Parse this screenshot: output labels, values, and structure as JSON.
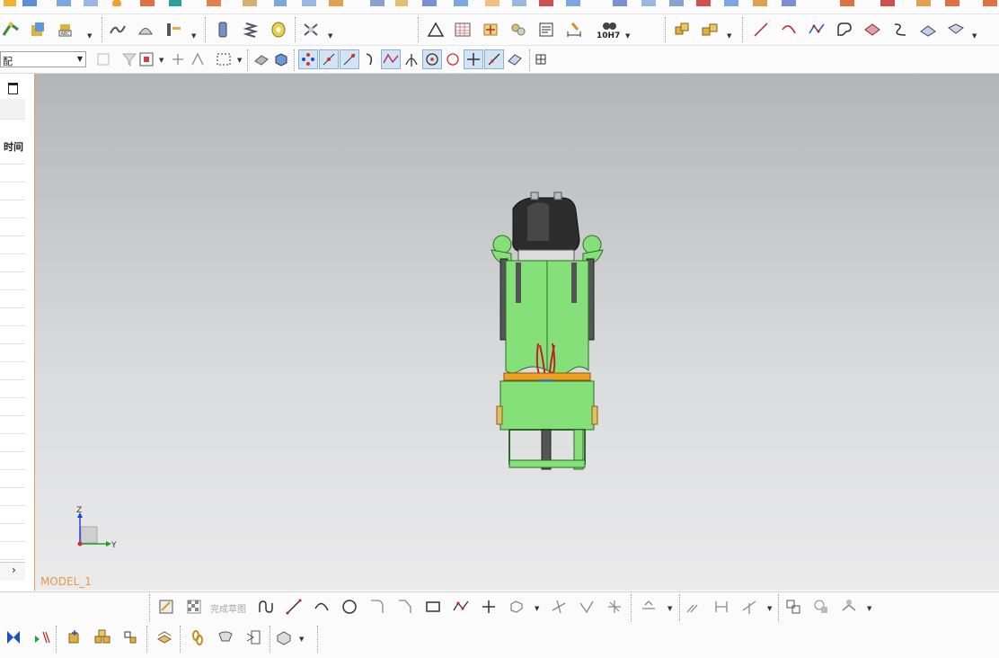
{
  "toolbar": {
    "combo_value": "配",
    "tolerance_label": "10H7"
  },
  "sidebar": {
    "time_header": "时间"
  },
  "viewport": {
    "model_name": "MODEL_1",
    "axis_z": "Z",
    "axis_y": "Y"
  },
  "sketch_toolbar": {
    "finish_sketch_label": "完成草图"
  },
  "colors": {
    "model_green": "#86e07a",
    "model_dark": "#2b2b2b",
    "accent_orange": "#e39a4a"
  }
}
